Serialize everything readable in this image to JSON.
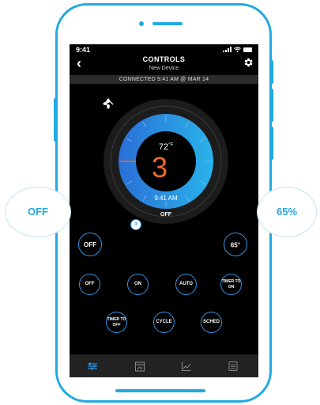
{
  "status_bar": {
    "time": "9:41"
  },
  "nav": {
    "title": "CONTROLS",
    "subtitle": "New Device"
  },
  "connection": {
    "text": "CONNECTED  9:41 AM @ MAR 14"
  },
  "dial": {
    "ambient_temp": "72",
    "temp_unit": "°F",
    "setpoint": "3",
    "time": "9:41 AM",
    "mode": "OFF",
    "knob_value": "3"
  },
  "buttons": {
    "left_main": "OFF",
    "right_main_value": "65",
    "right_main_unit": "%",
    "row1": [
      "OFF",
      "ON",
      "AUTO",
      "TIMER TO ON"
    ],
    "row2": [
      "TIMER TO OFF",
      "CYCLE",
      "SCHED"
    ]
  },
  "tabs": [
    "controls-tab",
    "calendar-tab",
    "chart-tab",
    "list-tab"
  ],
  "callouts": {
    "left": "OFF",
    "right": "65%"
  },
  "colors": {
    "accent": "#21a9e1",
    "dial_blue": "#2c8fe0",
    "setpoint_orange": "#ef6a2c",
    "screen_bg": "#000000"
  }
}
